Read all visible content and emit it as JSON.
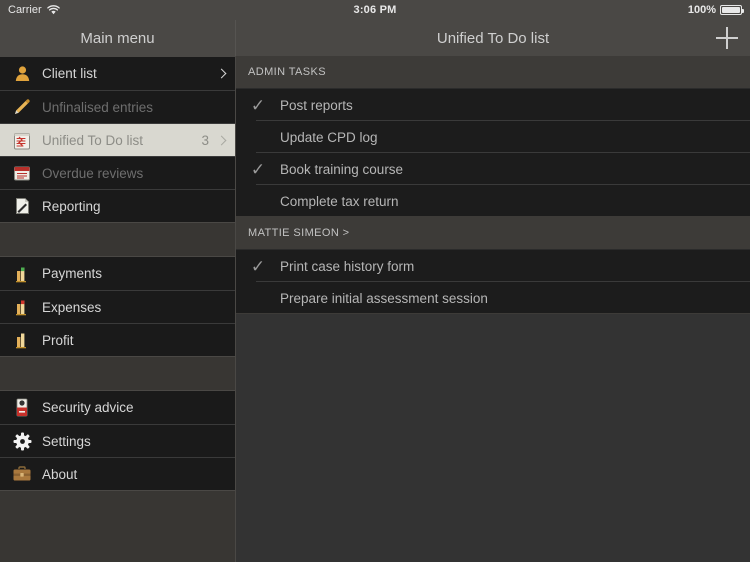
{
  "status_bar": {
    "carrier": "Carrier",
    "wifi_icon": "wifi-icon",
    "time": "3:06 PM",
    "battery_percent": "100%",
    "battery_icon": "battery-full-icon"
  },
  "nav": {
    "left_title": "Main menu",
    "right_title": "Unified To Do list",
    "add_icon": "plus-icon"
  },
  "sidebar": {
    "groups": [
      {
        "items": [
          {
            "label": "Client list",
            "icon": "person-icon",
            "state": "normal",
            "accessory": "chevron",
            "badge": ""
          },
          {
            "label": "Unfinalised entries",
            "icon": "pencil-icon",
            "state": "disabled",
            "accessory": "none",
            "badge": ""
          },
          {
            "label": "Unified To Do list",
            "icon": "notepad-icon",
            "state": "selected",
            "accessory": "chevron",
            "badge": "3"
          },
          {
            "label": "Overdue reviews",
            "icon": "calendar-icon",
            "state": "disabled",
            "accessory": "none",
            "badge": ""
          },
          {
            "label": "Reporting",
            "icon": "document-pen-icon",
            "state": "normal",
            "accessory": "none",
            "badge": ""
          }
        ]
      },
      {
        "items": [
          {
            "label": "Payments",
            "icon": "bar-chart-green-icon",
            "state": "normal",
            "accessory": "none",
            "badge": ""
          },
          {
            "label": "Expenses",
            "icon": "bar-chart-red-icon",
            "state": "normal",
            "accessory": "none",
            "badge": ""
          },
          {
            "label": "Profit",
            "icon": "bar-chart-gold-icon",
            "state": "normal",
            "accessory": "none",
            "badge": ""
          }
        ]
      },
      {
        "items": [
          {
            "label": "Security advice",
            "icon": "door-hanger-icon",
            "state": "normal",
            "accessory": "none",
            "badge": ""
          },
          {
            "label": "Settings",
            "icon": "gear-icon",
            "state": "normal",
            "accessory": "none",
            "badge": ""
          },
          {
            "label": "About",
            "icon": "briefcase-icon",
            "state": "normal",
            "accessory": "none",
            "badge": ""
          }
        ]
      }
    ]
  },
  "main": {
    "sections": [
      {
        "header": "ADMIN TASKS",
        "tasks": [
          {
            "title": "Post reports",
            "done": true
          },
          {
            "title": "Update CPD log",
            "done": false
          },
          {
            "title": "Book training course",
            "done": true
          },
          {
            "title": "Complete tax return",
            "done": false
          }
        ]
      },
      {
        "header": "MATTIE SIMEON >",
        "tasks": [
          {
            "title": "Print case history form",
            "done": true
          },
          {
            "title": "Prepare initial assessment session",
            "done": false
          }
        ]
      }
    ],
    "check_glyph": "✓"
  },
  "colors": {
    "chrome": "#4a4845",
    "sidebar_bg": "#383633",
    "row_bg": "#1a1a1a",
    "main_bg": "#333333",
    "selected_row": "#d9d8d0",
    "accent_gold": "#e0a33c"
  }
}
